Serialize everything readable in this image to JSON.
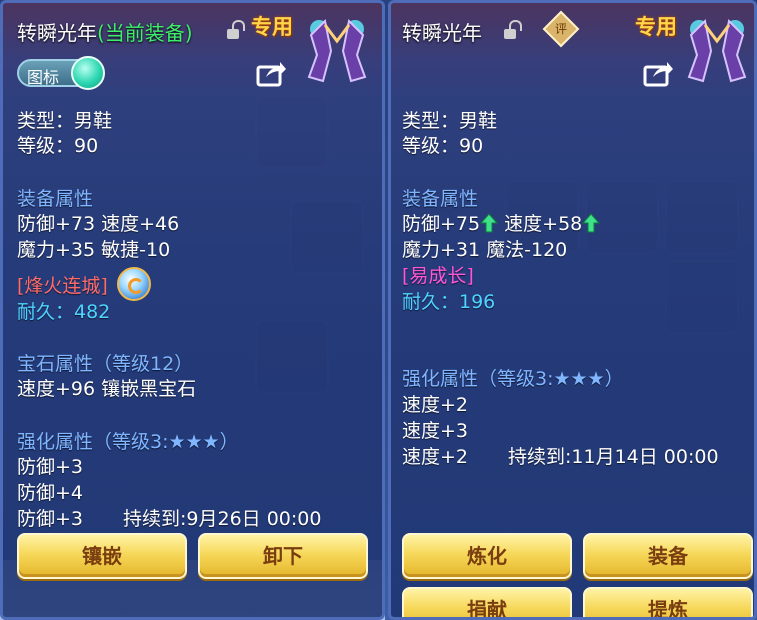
{
  "colors": {
    "accent_gold": "#ffd54a",
    "equipped_green": "#3cf06a",
    "section_blue": "#7fb6ff",
    "special_red": "#ff6a6a",
    "special_magenta": "#ff55d9",
    "durability_cyan": "#4fd3ff",
    "button_text": "#7a3d10"
  },
  "left": {
    "title": "转瞬光年",
    "equipped_tag": "(当前装备)",
    "exclusive": "专用",
    "icon_toggle_label": "图标",
    "type": "类型：男鞋",
    "level": "等级：90",
    "equip_attr_header": "装备属性",
    "attr_line1": "防御+73 速度+46",
    "attr_line2": "魔力+35 敏捷-10",
    "special_skill": "[烽火连城]",
    "durability": "耐久：482",
    "gem_header": "宝石属性（等级12）",
    "gem_line": "速度+96 镶嵌黑宝石",
    "enhance_header": "强化属性（等级3:★★★）",
    "enhance_lines": [
      "防御+3",
      "防御+4",
      "防御+3"
    ],
    "enhance_expire": "持续到:9月26日 00:00",
    "buttons": [
      "镶嵌",
      "卸下"
    ]
  },
  "right": {
    "title": "转瞬光年",
    "eval_badge": "评",
    "exclusive": "专用",
    "type": "类型：男鞋",
    "level": "等级：90",
    "equip_attr_header": "装备属性",
    "attr_line1_a": "防御+75",
    "attr_line1_b": "速度+58",
    "attr_line2": "魔力+31 魔法-120",
    "special_skill": "[易成长]",
    "durability": "耐久：196",
    "enhance_header": "强化属性（等级3:★★★）",
    "enhance_lines": [
      "速度+2",
      "速度+3",
      "速度+2"
    ],
    "enhance_expire": "持续到:11月14日 00:00",
    "buttons": [
      "炼化",
      "装备",
      "捐献",
      "提炼"
    ]
  }
}
